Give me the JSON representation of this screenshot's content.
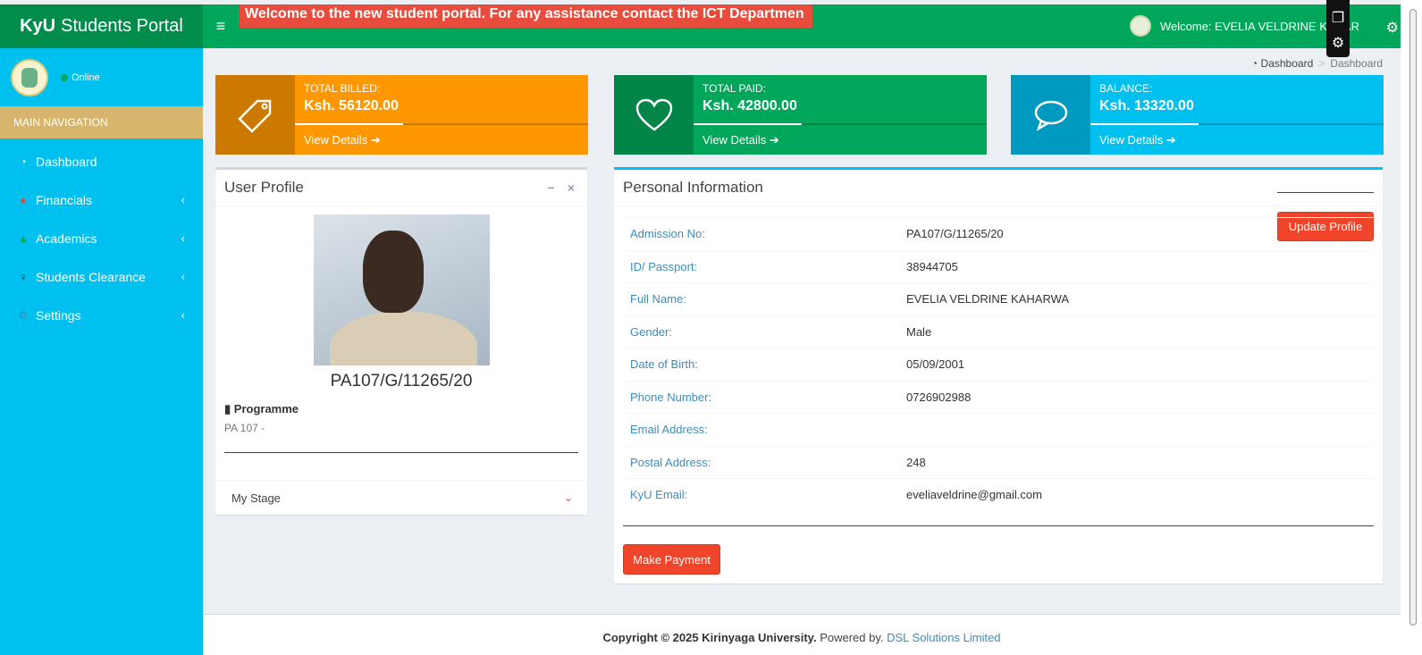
{
  "header": {
    "app_title_bold": "KyU",
    "app_title_rest": "Students Portal",
    "marquee": "Welcome to the new student portal. For any assistance contact the ICT Departmen",
    "welcome": "Welcome: EVELIA VELDRINE KAHAR"
  },
  "sidebar": {
    "status": "Online",
    "nav_header": "MAIN NAVIGATION",
    "items": [
      {
        "label": "Dashboard"
      },
      {
        "label": "Financials"
      },
      {
        "label": "Academics"
      },
      {
        "label": "Students Clearance"
      },
      {
        "label": "Settings"
      }
    ]
  },
  "breadcrumb": {
    "home": "Dashboard",
    "current": "Dashboard"
  },
  "stats": [
    {
      "label": "TOTAL BILLED:",
      "value": "Ksh. 56120.00",
      "link": "View Details",
      "color": "#ff9800",
      "progress_fraction": 0.37
    },
    {
      "label": "TOTAL PAID:",
      "value": "Ksh. 42800.00",
      "link": "View Details",
      "color": "#00a65a",
      "progress_fraction": 0.37
    },
    {
      "label": "BALANCE:",
      "value": "Ksh. 13320.00",
      "link": "View Details",
      "color": "#00c0ef",
      "progress_fraction": 0.37
    }
  ],
  "user_profile": {
    "title": "User Profile",
    "name": "PA107/G/11265/20",
    "programme_label": "Programme",
    "programme_value": "PA 107 -",
    "stage_label": "My Stage"
  },
  "personal_info": {
    "title": "Personal Information",
    "update_button": "Update Profile",
    "rows": [
      {
        "key": "Admission No:",
        "value": "PA107/G/11265/20"
      },
      {
        "key": "ID/ Passport:",
        "value": "38944705"
      },
      {
        "key": "Full Name:",
        "value": "EVELIA VELDRINE KAHARWA"
      },
      {
        "key": "Gender:",
        "value": "Male"
      },
      {
        "key": "Date of Birth:",
        "value": "05/09/2001"
      },
      {
        "key": "Phone Number:",
        "value": "0726902988"
      },
      {
        "key": "Email Address:",
        "value": ""
      },
      {
        "key": "Postal Address:",
        "value": "248"
      },
      {
        "key": "KyU Email:",
        "value": "eveliaveldrine@gmail.com"
      }
    ],
    "payment_button": "Make Payment"
  },
  "footer": {
    "copyright": "Copyright © 2025",
    "org": "Kirinyaga University.",
    "powered": "Powered by.",
    "vendor": "DSL Solutions Limited"
  }
}
